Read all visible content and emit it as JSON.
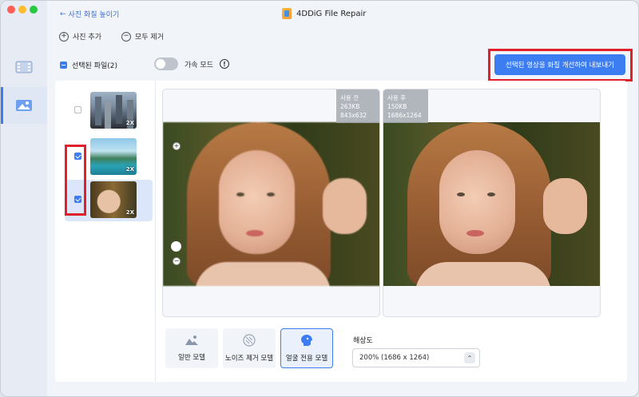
{
  "window": {
    "title": "4DDiG File Repair"
  },
  "nav": {
    "back_label": "사진 화질 높이기"
  },
  "toolbar": {
    "add_label": "사진 추가",
    "remove_all_label": "모두 제거"
  },
  "selection": {
    "label": "선택된 파일(2)",
    "accel_label": "가속 모드",
    "accel_enabled": false
  },
  "export": {
    "label": "선택된 영상을 화질 개선하여 내보내기"
  },
  "files": [
    {
      "checked": false,
      "badge": "2X",
      "thumb": "city"
    },
    {
      "checked": true,
      "badge": "2X",
      "thumb": "lake"
    },
    {
      "checked": true,
      "badge": "2X",
      "thumb": "portrait",
      "active": true
    }
  ],
  "compare": {
    "before": {
      "label": "사용 전",
      "size": "263KB",
      "dims": "843x632"
    },
    "after": {
      "label": "사용 후",
      "size": "150KB",
      "dims": "1686x1264"
    }
  },
  "models": [
    {
      "label": "일반 모델",
      "icon": "landscape-icon",
      "active": false
    },
    {
      "label": "노이즈 제거 모델",
      "icon": "noise-icon",
      "active": false
    },
    {
      "label": "얼굴 전용 모델",
      "icon": "face-icon",
      "active": true
    }
  ],
  "resolution": {
    "label": "해상도",
    "value": "200% (1686 x 1264)"
  },
  "colors": {
    "accent": "#3c7df2",
    "highlight": "#e0202a"
  }
}
